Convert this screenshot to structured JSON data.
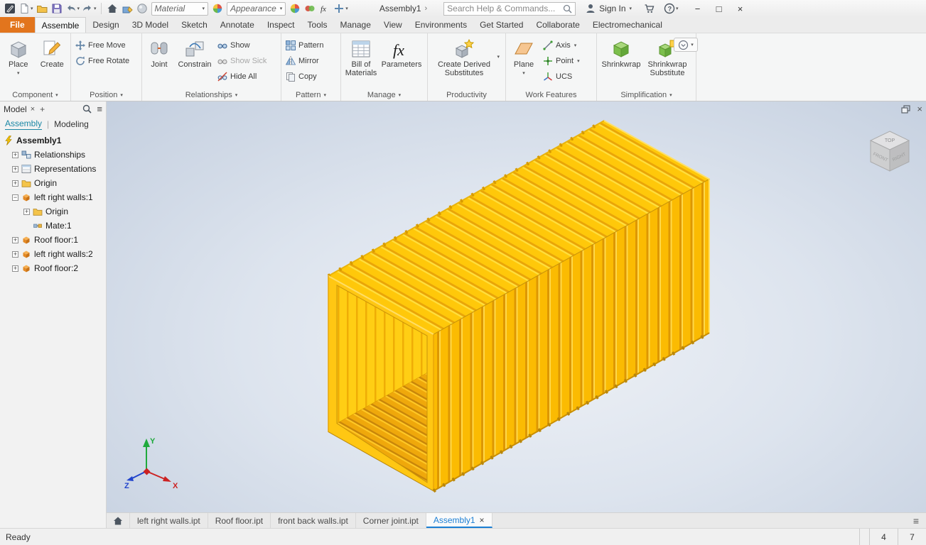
{
  "titlebar": {
    "material_label": "Material",
    "appearance_label": "Appearance",
    "doc_title": "Assembly1",
    "search_placeholder": "Search Help & Commands...",
    "sign_in_label": "Sign In"
  },
  "glyphs": {
    "dropdown": "▾",
    "close": "×",
    "minimize": "−",
    "maximize": "□",
    "hamburger": "≡",
    "plus": "+",
    "expand": "+",
    "collapse": "−",
    "chevron": "›",
    "question": "?",
    "fx": "fx"
  },
  "ribbon_tabs": {
    "file": "File",
    "tabs": [
      {
        "label": "Assemble",
        "active": true
      },
      {
        "label": "Design"
      },
      {
        "label": "3D Model"
      },
      {
        "label": "Sketch"
      },
      {
        "label": "Annotate"
      },
      {
        "label": "Inspect"
      },
      {
        "label": "Tools"
      },
      {
        "label": "Manage"
      },
      {
        "label": "View"
      },
      {
        "label": "Environments"
      },
      {
        "label": "Get Started"
      },
      {
        "label": "Collaborate"
      },
      {
        "label": "Electromechanical"
      }
    ]
  },
  "ribbon": {
    "component": {
      "group_label": "Component",
      "place": "Place",
      "create": "Create"
    },
    "position": {
      "group_label": "Position",
      "free_move": "Free Move",
      "free_rotate": "Free Rotate"
    },
    "relationships": {
      "group_label": "Relationships",
      "joint": "Joint",
      "constrain": "Constrain",
      "show": "Show",
      "show_sick": "Show Sick",
      "hide_all": "Hide All"
    },
    "pattern": {
      "group_label": "Pattern",
      "pattern": "Pattern",
      "mirror": "Mirror",
      "copy": "Copy"
    },
    "manage": {
      "group_label": "Manage",
      "bom": "Bill of Materials",
      "parameters": "Parameters"
    },
    "productivity": {
      "group_label": "Productivity",
      "create_derived": "Create Derived Substitutes"
    },
    "work_features": {
      "group_label": "Work Features",
      "plane": "Plane",
      "axis": "Axis",
      "point": "Point",
      "ucs": "UCS"
    },
    "simplification": {
      "group_label": "Simplification",
      "shrinkwrap": "Shrinkwrap",
      "shrinkwrap_substitute": "Shrinkwrap Substitute"
    }
  },
  "browser": {
    "panel_title": "Model",
    "tab_assembly": "Assembly",
    "tab_modeling": "Modeling",
    "tree": [
      {
        "label": "Assembly1",
        "icon": "assembly"
      },
      {
        "label": "Relationships",
        "icon": "relationships-folder"
      },
      {
        "label": "Representations",
        "icon": "representations"
      },
      {
        "label": "Origin",
        "icon": "folder"
      },
      {
        "label": "left right walls:1",
        "icon": "part"
      },
      {
        "label": "Origin",
        "icon": "folder"
      },
      {
        "label": "Mate:1",
        "icon": "mate"
      },
      {
        "label": "Roof floor:1",
        "icon": "part"
      },
      {
        "label": "left right walls:2",
        "icon": "part"
      },
      {
        "label": "Roof floor:2",
        "icon": "part"
      }
    ]
  },
  "viewport": {
    "viewcube": {
      "top": "TOP",
      "front": "FRONT",
      "right": "RIGHT"
    },
    "triad": {
      "x": "X",
      "y": "Y",
      "z": "Z"
    }
  },
  "doc_tabs": {
    "tabs": [
      "left right walls.ipt",
      "Roof floor.ipt",
      "front back walls.ipt",
      "Corner joint.ipt",
      "Assembly1"
    ],
    "active": "Assembly1"
  },
  "statusbar": {
    "message": "Ready",
    "count_left": "4",
    "count_right": "7"
  },
  "colors": {
    "container_yellow": "#FFC80A",
    "container_shadow": "#E9A508",
    "file_tab_orange": "#E2751D",
    "active_doc_tab_blue": "#1B7FD4",
    "browser_assembly_teal": "#1B87A5"
  }
}
